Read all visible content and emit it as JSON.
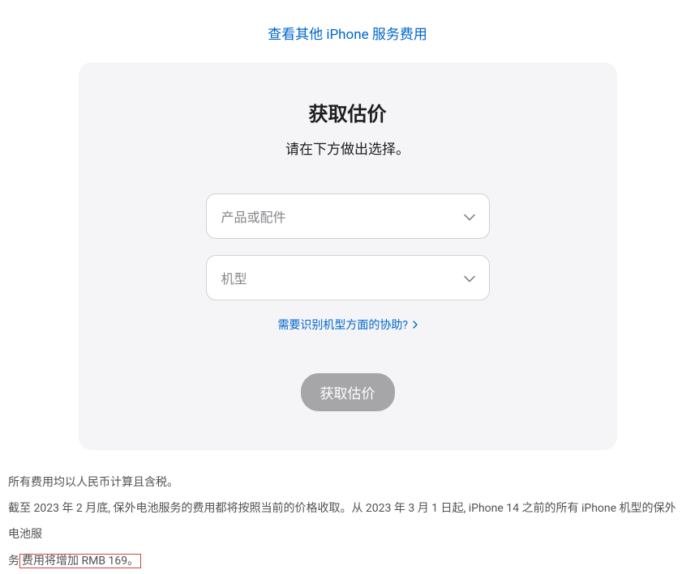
{
  "topLink": {
    "text": "查看其他 iPhone 服务费用"
  },
  "card": {
    "title": "获取估价",
    "subtitle": "请在下方做出选择。",
    "selectProduct": {
      "placeholder": "产品或配件"
    },
    "selectModel": {
      "placeholder": "机型"
    },
    "helpLink": {
      "text": "需要识别机型方面的协助?"
    },
    "submitButton": {
      "label": "获取估价"
    }
  },
  "footer": {
    "note1": "所有费用均以人民币计算且含税。",
    "note2_part1": "截至 2023 年 2 月底, 保外电池服务的费用都将按照当前的价格收取。从 2023 年 3 月 1 日起, iPhone 14 之前的所有 iPhone 机型的保外电池服",
    "note2_part2": "务",
    "note2_highlight": "费用将增加 RMB 169。"
  }
}
